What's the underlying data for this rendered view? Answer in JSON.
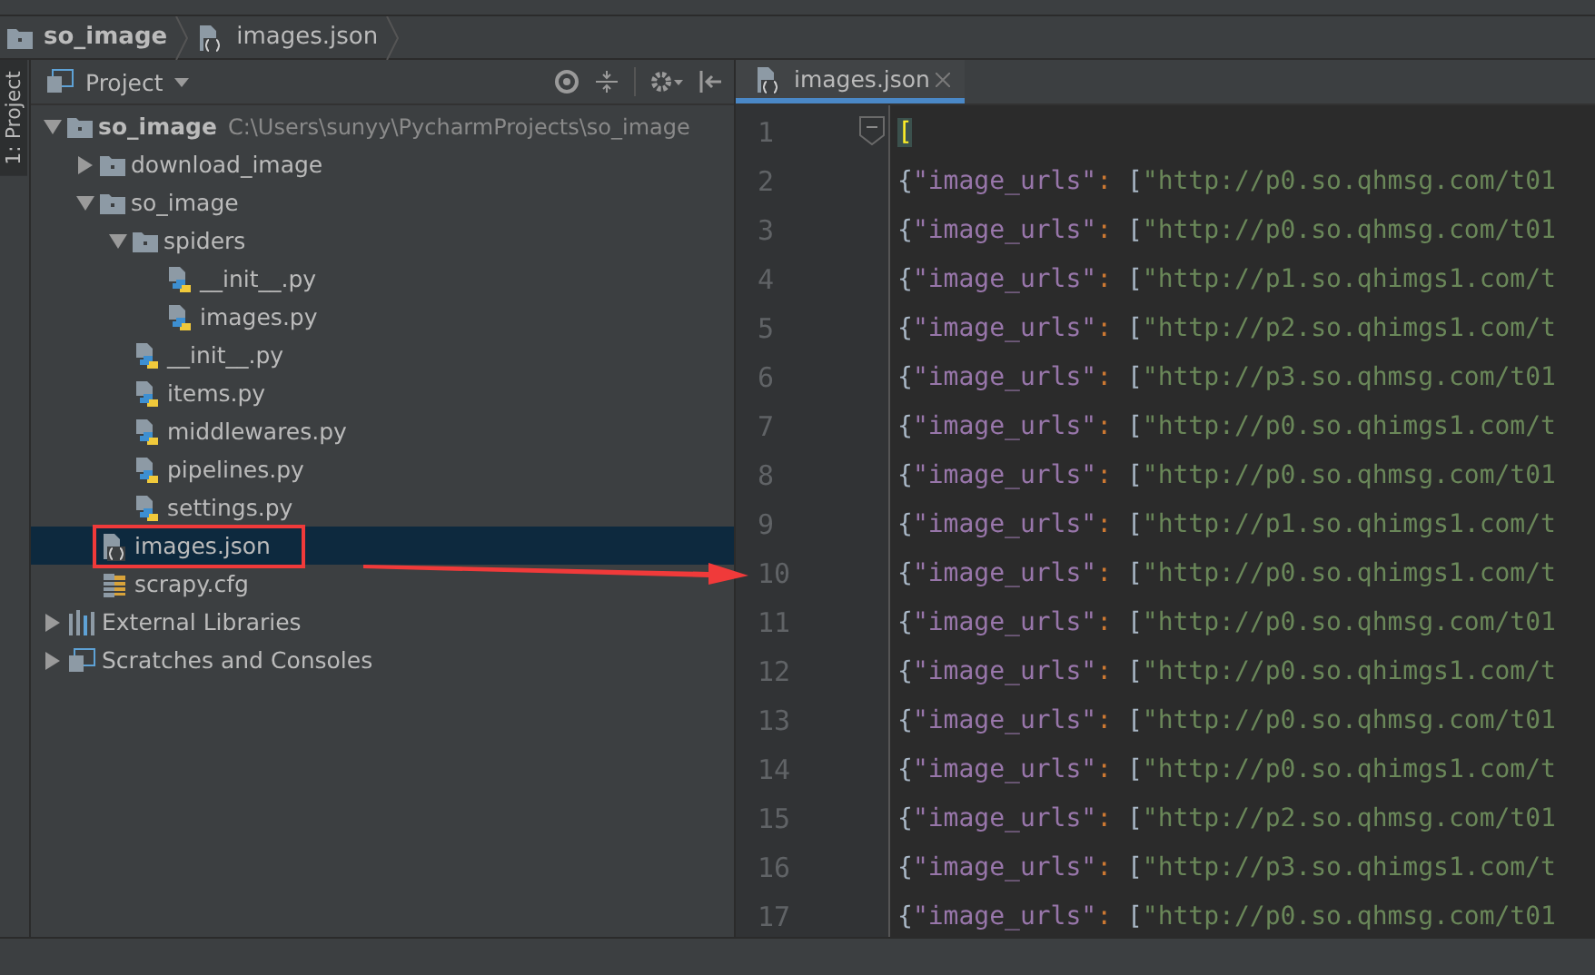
{
  "breadcrumbs": [
    {
      "kind": "folder",
      "label": "so_image"
    },
    {
      "kind": "json",
      "label": "images.json"
    }
  ],
  "side_strip": {
    "label": "1: Project"
  },
  "project_panel": {
    "title": "Project",
    "tree": [
      {
        "kind": "folder",
        "label": "so_image",
        "hint": "C:\\Users\\sunyy\\PycharmProjects\\so_image",
        "expanded": true,
        "selected": false,
        "children": [
          {
            "kind": "folder",
            "label": "download_image",
            "expanded": false,
            "selected": false
          },
          {
            "kind": "folder",
            "label": "so_image",
            "expanded": true,
            "selected": false,
            "children": [
              {
                "kind": "folder",
                "label": "spiders",
                "expanded": true,
                "selected": false,
                "children": [
                  {
                    "kind": "py",
                    "label": "__init__.py",
                    "selected": false
                  },
                  {
                    "kind": "py",
                    "label": "images.py",
                    "selected": false
                  }
                ]
              },
              {
                "kind": "py",
                "label": "__init__.py",
                "selected": false
              },
              {
                "kind": "py",
                "label": "items.py",
                "selected": false
              },
              {
                "kind": "py",
                "label": "middlewares.py",
                "selected": false
              },
              {
                "kind": "py",
                "label": "pipelines.py",
                "selected": false
              },
              {
                "kind": "py",
                "label": "settings.py",
                "selected": false
              }
            ]
          },
          {
            "kind": "json",
            "label": "images.json",
            "selected": true
          },
          {
            "kind": "cfg",
            "label": "scrapy.cfg",
            "selected": false
          }
        ]
      },
      {
        "kind": "libs",
        "label": "External Libraries",
        "expanded": false,
        "selected": false
      },
      {
        "kind": "scratch",
        "label": "Scratches and Consoles",
        "expanded": false,
        "selected": false
      }
    ]
  },
  "editor": {
    "tabs": [
      {
        "label": "images.json",
        "selected": true
      }
    ],
    "lines": [
      {
        "number": "1",
        "tokens": [
          {
            "kind": "bracket-hl",
            "text": "["
          }
        ]
      },
      {
        "number": "2",
        "tokens": [
          {
            "kind": "brace",
            "text": "{"
          },
          {
            "kind": "key",
            "text": "\"image_urls\""
          },
          {
            "kind": "colon",
            "text": ": "
          },
          {
            "kind": "brace",
            "text": "["
          },
          {
            "kind": "string",
            "text": "\"http://p0.so.qhmsg.com/t01"
          }
        ]
      },
      {
        "number": "3",
        "tokens": [
          {
            "kind": "brace",
            "text": "{"
          },
          {
            "kind": "key",
            "text": "\"image_urls\""
          },
          {
            "kind": "colon",
            "text": ": "
          },
          {
            "kind": "brace",
            "text": "["
          },
          {
            "kind": "string",
            "text": "\"http://p0.so.qhmsg.com/t01"
          }
        ]
      },
      {
        "number": "4",
        "tokens": [
          {
            "kind": "brace",
            "text": "{"
          },
          {
            "kind": "key",
            "text": "\"image_urls\""
          },
          {
            "kind": "colon",
            "text": ": "
          },
          {
            "kind": "brace",
            "text": "["
          },
          {
            "kind": "string",
            "text": "\"http://p1.so.qhimgs1.com/t"
          }
        ]
      },
      {
        "number": "5",
        "tokens": [
          {
            "kind": "brace",
            "text": "{"
          },
          {
            "kind": "key",
            "text": "\"image_urls\""
          },
          {
            "kind": "colon",
            "text": ": "
          },
          {
            "kind": "brace",
            "text": "["
          },
          {
            "kind": "string",
            "text": "\"http://p2.so.qhimgs1.com/t"
          }
        ]
      },
      {
        "number": "6",
        "tokens": [
          {
            "kind": "brace",
            "text": "{"
          },
          {
            "kind": "key",
            "text": "\"image_urls\""
          },
          {
            "kind": "colon",
            "text": ": "
          },
          {
            "kind": "brace",
            "text": "["
          },
          {
            "kind": "string",
            "text": "\"http://p3.so.qhmsg.com/t01"
          }
        ]
      },
      {
        "number": "7",
        "tokens": [
          {
            "kind": "brace",
            "text": "{"
          },
          {
            "kind": "key",
            "text": "\"image_urls\""
          },
          {
            "kind": "colon",
            "text": ": "
          },
          {
            "kind": "brace",
            "text": "["
          },
          {
            "kind": "string",
            "text": "\"http://p0.so.qhimgs1.com/t"
          }
        ]
      },
      {
        "number": "8",
        "tokens": [
          {
            "kind": "brace",
            "text": "{"
          },
          {
            "kind": "key",
            "text": "\"image_urls\""
          },
          {
            "kind": "colon",
            "text": ": "
          },
          {
            "kind": "brace",
            "text": "["
          },
          {
            "kind": "string",
            "text": "\"http://p0.so.qhmsg.com/t01"
          }
        ]
      },
      {
        "number": "9",
        "tokens": [
          {
            "kind": "brace",
            "text": "{"
          },
          {
            "kind": "key",
            "text": "\"image_urls\""
          },
          {
            "kind": "colon",
            "text": ": "
          },
          {
            "kind": "brace",
            "text": "["
          },
          {
            "kind": "string",
            "text": "\"http://p1.so.qhimgs1.com/t"
          }
        ]
      },
      {
        "number": "10",
        "tokens": [
          {
            "kind": "brace",
            "text": "{"
          },
          {
            "kind": "key",
            "text": "\"image_urls\""
          },
          {
            "kind": "colon",
            "text": ": "
          },
          {
            "kind": "brace",
            "text": "["
          },
          {
            "kind": "string",
            "text": "\"http://p0.so.qhimgs1.com/t"
          }
        ]
      },
      {
        "number": "11",
        "tokens": [
          {
            "kind": "brace",
            "text": "{"
          },
          {
            "kind": "key",
            "text": "\"image_urls\""
          },
          {
            "kind": "colon",
            "text": ": "
          },
          {
            "kind": "brace",
            "text": "["
          },
          {
            "kind": "string",
            "text": "\"http://p0.so.qhmsg.com/t01"
          }
        ]
      },
      {
        "number": "12",
        "tokens": [
          {
            "kind": "brace",
            "text": "{"
          },
          {
            "kind": "key",
            "text": "\"image_urls\""
          },
          {
            "kind": "colon",
            "text": ": "
          },
          {
            "kind": "brace",
            "text": "["
          },
          {
            "kind": "string",
            "text": "\"http://p0.so.qhimgs1.com/t"
          }
        ]
      },
      {
        "number": "13",
        "tokens": [
          {
            "kind": "brace",
            "text": "{"
          },
          {
            "kind": "key",
            "text": "\"image_urls\""
          },
          {
            "kind": "colon",
            "text": ": "
          },
          {
            "kind": "brace",
            "text": "["
          },
          {
            "kind": "string",
            "text": "\"http://p0.so.qhmsg.com/t01"
          }
        ]
      },
      {
        "number": "14",
        "tokens": [
          {
            "kind": "brace",
            "text": "{"
          },
          {
            "kind": "key",
            "text": "\"image_urls\""
          },
          {
            "kind": "colon",
            "text": ": "
          },
          {
            "kind": "brace",
            "text": "["
          },
          {
            "kind": "string",
            "text": "\"http://p0.so.qhimgs1.com/t"
          }
        ]
      },
      {
        "number": "15",
        "tokens": [
          {
            "kind": "brace",
            "text": "{"
          },
          {
            "kind": "key",
            "text": "\"image_urls\""
          },
          {
            "kind": "colon",
            "text": ": "
          },
          {
            "kind": "brace",
            "text": "["
          },
          {
            "kind": "string",
            "text": "\"http://p2.so.qhmsg.com/t01"
          }
        ]
      },
      {
        "number": "16",
        "tokens": [
          {
            "kind": "brace",
            "text": "{"
          },
          {
            "kind": "key",
            "text": "\"image_urls\""
          },
          {
            "kind": "colon",
            "text": ": "
          },
          {
            "kind": "brace",
            "text": "["
          },
          {
            "kind": "string",
            "text": "\"http://p3.so.qhimgs1.com/t"
          }
        ]
      },
      {
        "number": "17",
        "tokens": [
          {
            "kind": "brace",
            "text": "{"
          },
          {
            "kind": "key",
            "text": "\"image_urls\""
          },
          {
            "kind": "colon",
            "text": ": "
          },
          {
            "kind": "brace",
            "text": "["
          },
          {
            "kind": "string",
            "text": "\"http://p0.so.qhmsg.com/t01"
          }
        ]
      }
    ]
  }
}
